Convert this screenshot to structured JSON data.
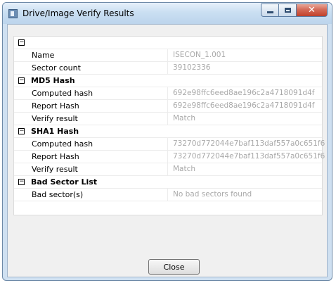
{
  "window": {
    "title": "Drive/Image Verify Results",
    "close_label": "Close"
  },
  "sections": [
    {
      "name": "",
      "rows": [
        {
          "label": "Name",
          "value": "ISECON_1.001"
        },
        {
          "label": "Sector count",
          "value": "39102336"
        }
      ]
    },
    {
      "name": "MD5 Hash",
      "rows": [
        {
          "label": "Computed hash",
          "value": "692e98ffc6eed8ae196c2a4718091d4f"
        },
        {
          "label": "Report Hash",
          "value": "692e98ffc6eed8ae196c2a4718091d4f"
        },
        {
          "label": "Verify result",
          "value": "Match"
        }
      ]
    },
    {
      "name": "SHA1 Hash",
      "rows": [
        {
          "label": "Computed hash",
          "value": "73270d772044e7baf113daf557a0c651f6"
        },
        {
          "label": "Report Hash",
          "value": "73270d772044e7baf113daf557a0c651f6"
        },
        {
          "label": "Verify result",
          "value": "Match"
        }
      ]
    },
    {
      "name": "Bad Sector List",
      "rows": [
        {
          "label": "Bad sector(s)",
          "value": "No bad sectors found"
        }
      ]
    }
  ],
  "icons": {
    "collapse": "minus-box-icon",
    "app": "window-app-icon"
  }
}
